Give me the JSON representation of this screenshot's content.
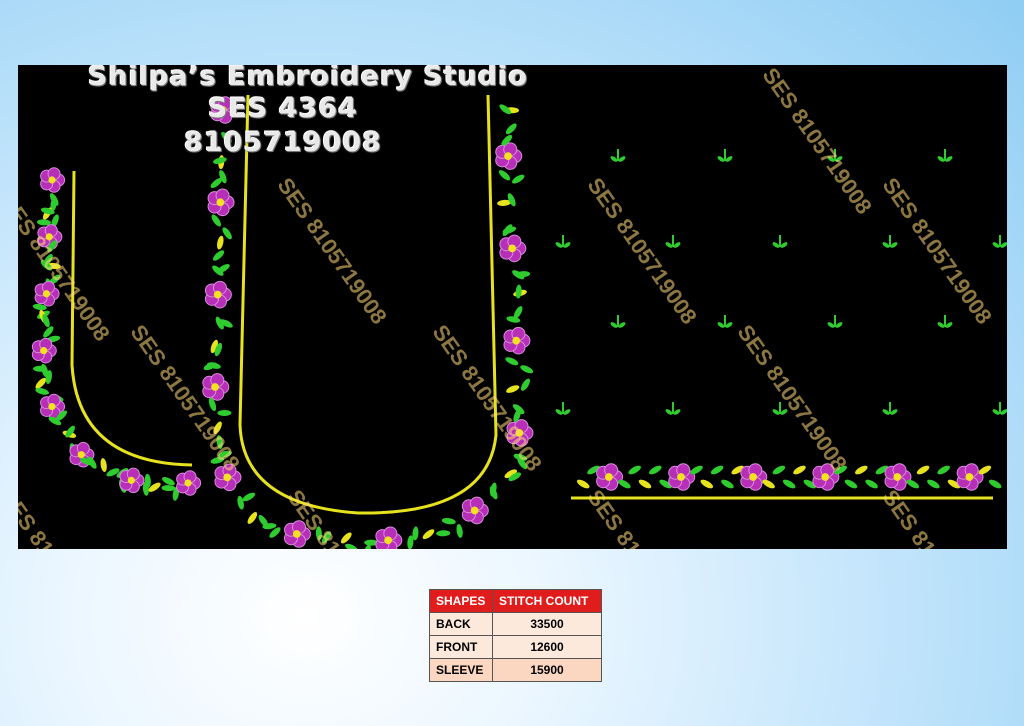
{
  "header": {
    "studio": "Shilpa’s Embroidery Studio",
    "design_code": "SES 4364",
    "phone": "8105719008"
  },
  "watermark": "SES 8105719008",
  "colors": {
    "thread_gold": "#e6e21e",
    "flower_magenta": "#b62fb6",
    "leaf_green": "#2ecc2e",
    "header_red": "#e01c1c"
  },
  "table": {
    "headers": [
      "SHAPES",
      "STITCH COUNT"
    ],
    "rows": [
      {
        "shape": "BACK",
        "count": "33500"
      },
      {
        "shape": "FRONT",
        "count": "12600"
      },
      {
        "shape": "SLEEVE",
        "count": "15900"
      }
    ]
  }
}
